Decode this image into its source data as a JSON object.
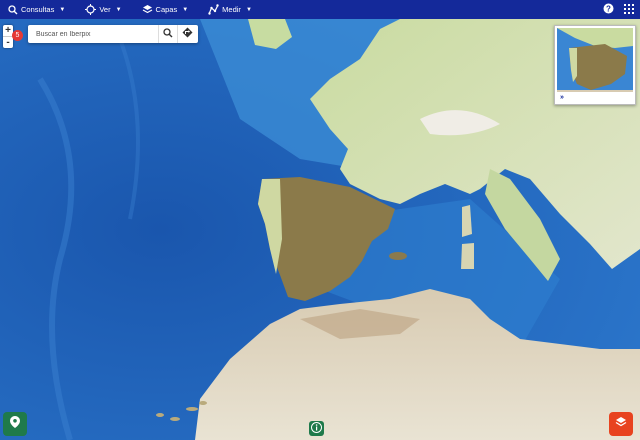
{
  "topbar": {
    "menus": [
      {
        "label": "Consultas",
        "icon": "search-icon"
      },
      {
        "label": "Ver",
        "icon": "crosshair-icon"
      },
      {
        "label": "Capas",
        "icon": "layers-icon"
      },
      {
        "label": "Medir",
        "icon": "measure-icon"
      }
    ],
    "right_icons": [
      "help-icon",
      "apps-grid-icon"
    ]
  },
  "zoom": {
    "in": "+",
    "out": "-"
  },
  "badge": {
    "count": "5"
  },
  "search": {
    "placeholder": "Buscar en Iberpix",
    "icons": [
      "search-icon",
      "directions-icon"
    ]
  },
  "overview": {
    "toggle": "»"
  },
  "buttons": {
    "location_icon": "location-pin-icon",
    "info_icon": "info-icon",
    "layers_icon": "layers-icon"
  },
  "colors": {
    "topbar": "#14299a",
    "ocean": "#1d5fb8",
    "green_button": "#1f7a4b",
    "red_button": "#e8431f",
    "badge": "#e53935"
  }
}
